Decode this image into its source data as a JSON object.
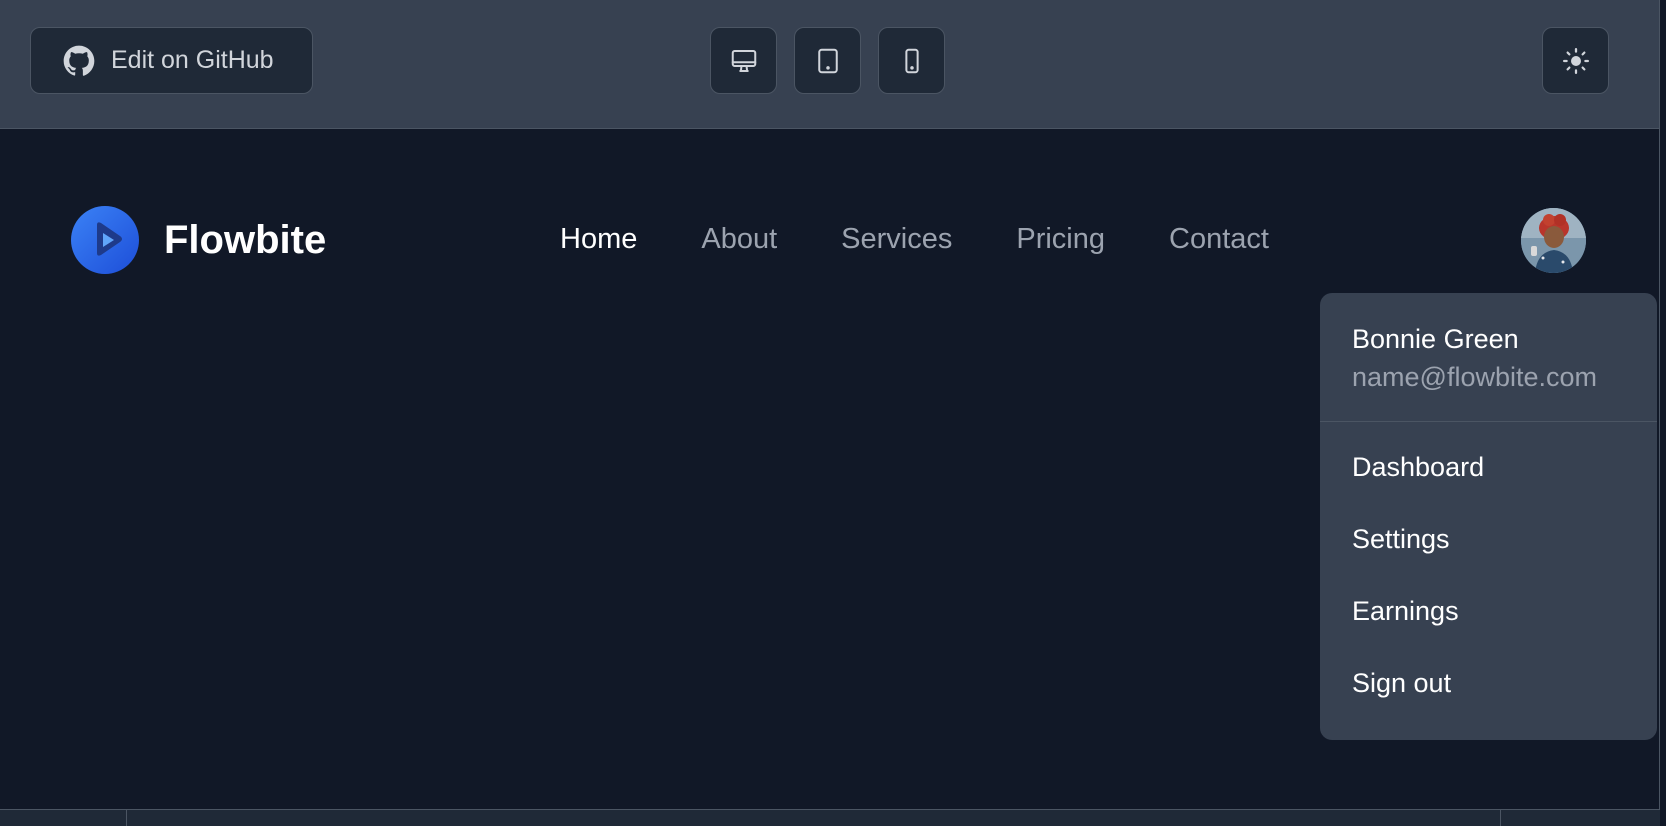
{
  "toolbar": {
    "github_label": "Edit on GitHub",
    "icons": {
      "github": "github-icon",
      "desktop": "desktop-icon",
      "tablet": "tablet-icon",
      "mobile": "mobile-icon",
      "theme": "sun-icon"
    }
  },
  "navbar": {
    "brand": "Flowbite",
    "links": [
      {
        "label": "Home",
        "active": true
      },
      {
        "label": "About",
        "active": false
      },
      {
        "label": "Services",
        "active": false
      },
      {
        "label": "Pricing",
        "active": false
      },
      {
        "label": "Contact",
        "active": false
      }
    ]
  },
  "user_menu": {
    "name": "Bonnie Green",
    "email": "name@flowbite.com",
    "items": [
      {
        "label": "Dashboard"
      },
      {
        "label": "Settings"
      },
      {
        "label": "Earnings"
      },
      {
        "label": "Sign out"
      }
    ]
  },
  "colors": {
    "toolbar_bg": "#374151",
    "page_bg": "#111827",
    "brand_blue": "#2563eb",
    "active_text": "#ffffff",
    "muted_text": "#9ca3af"
  }
}
